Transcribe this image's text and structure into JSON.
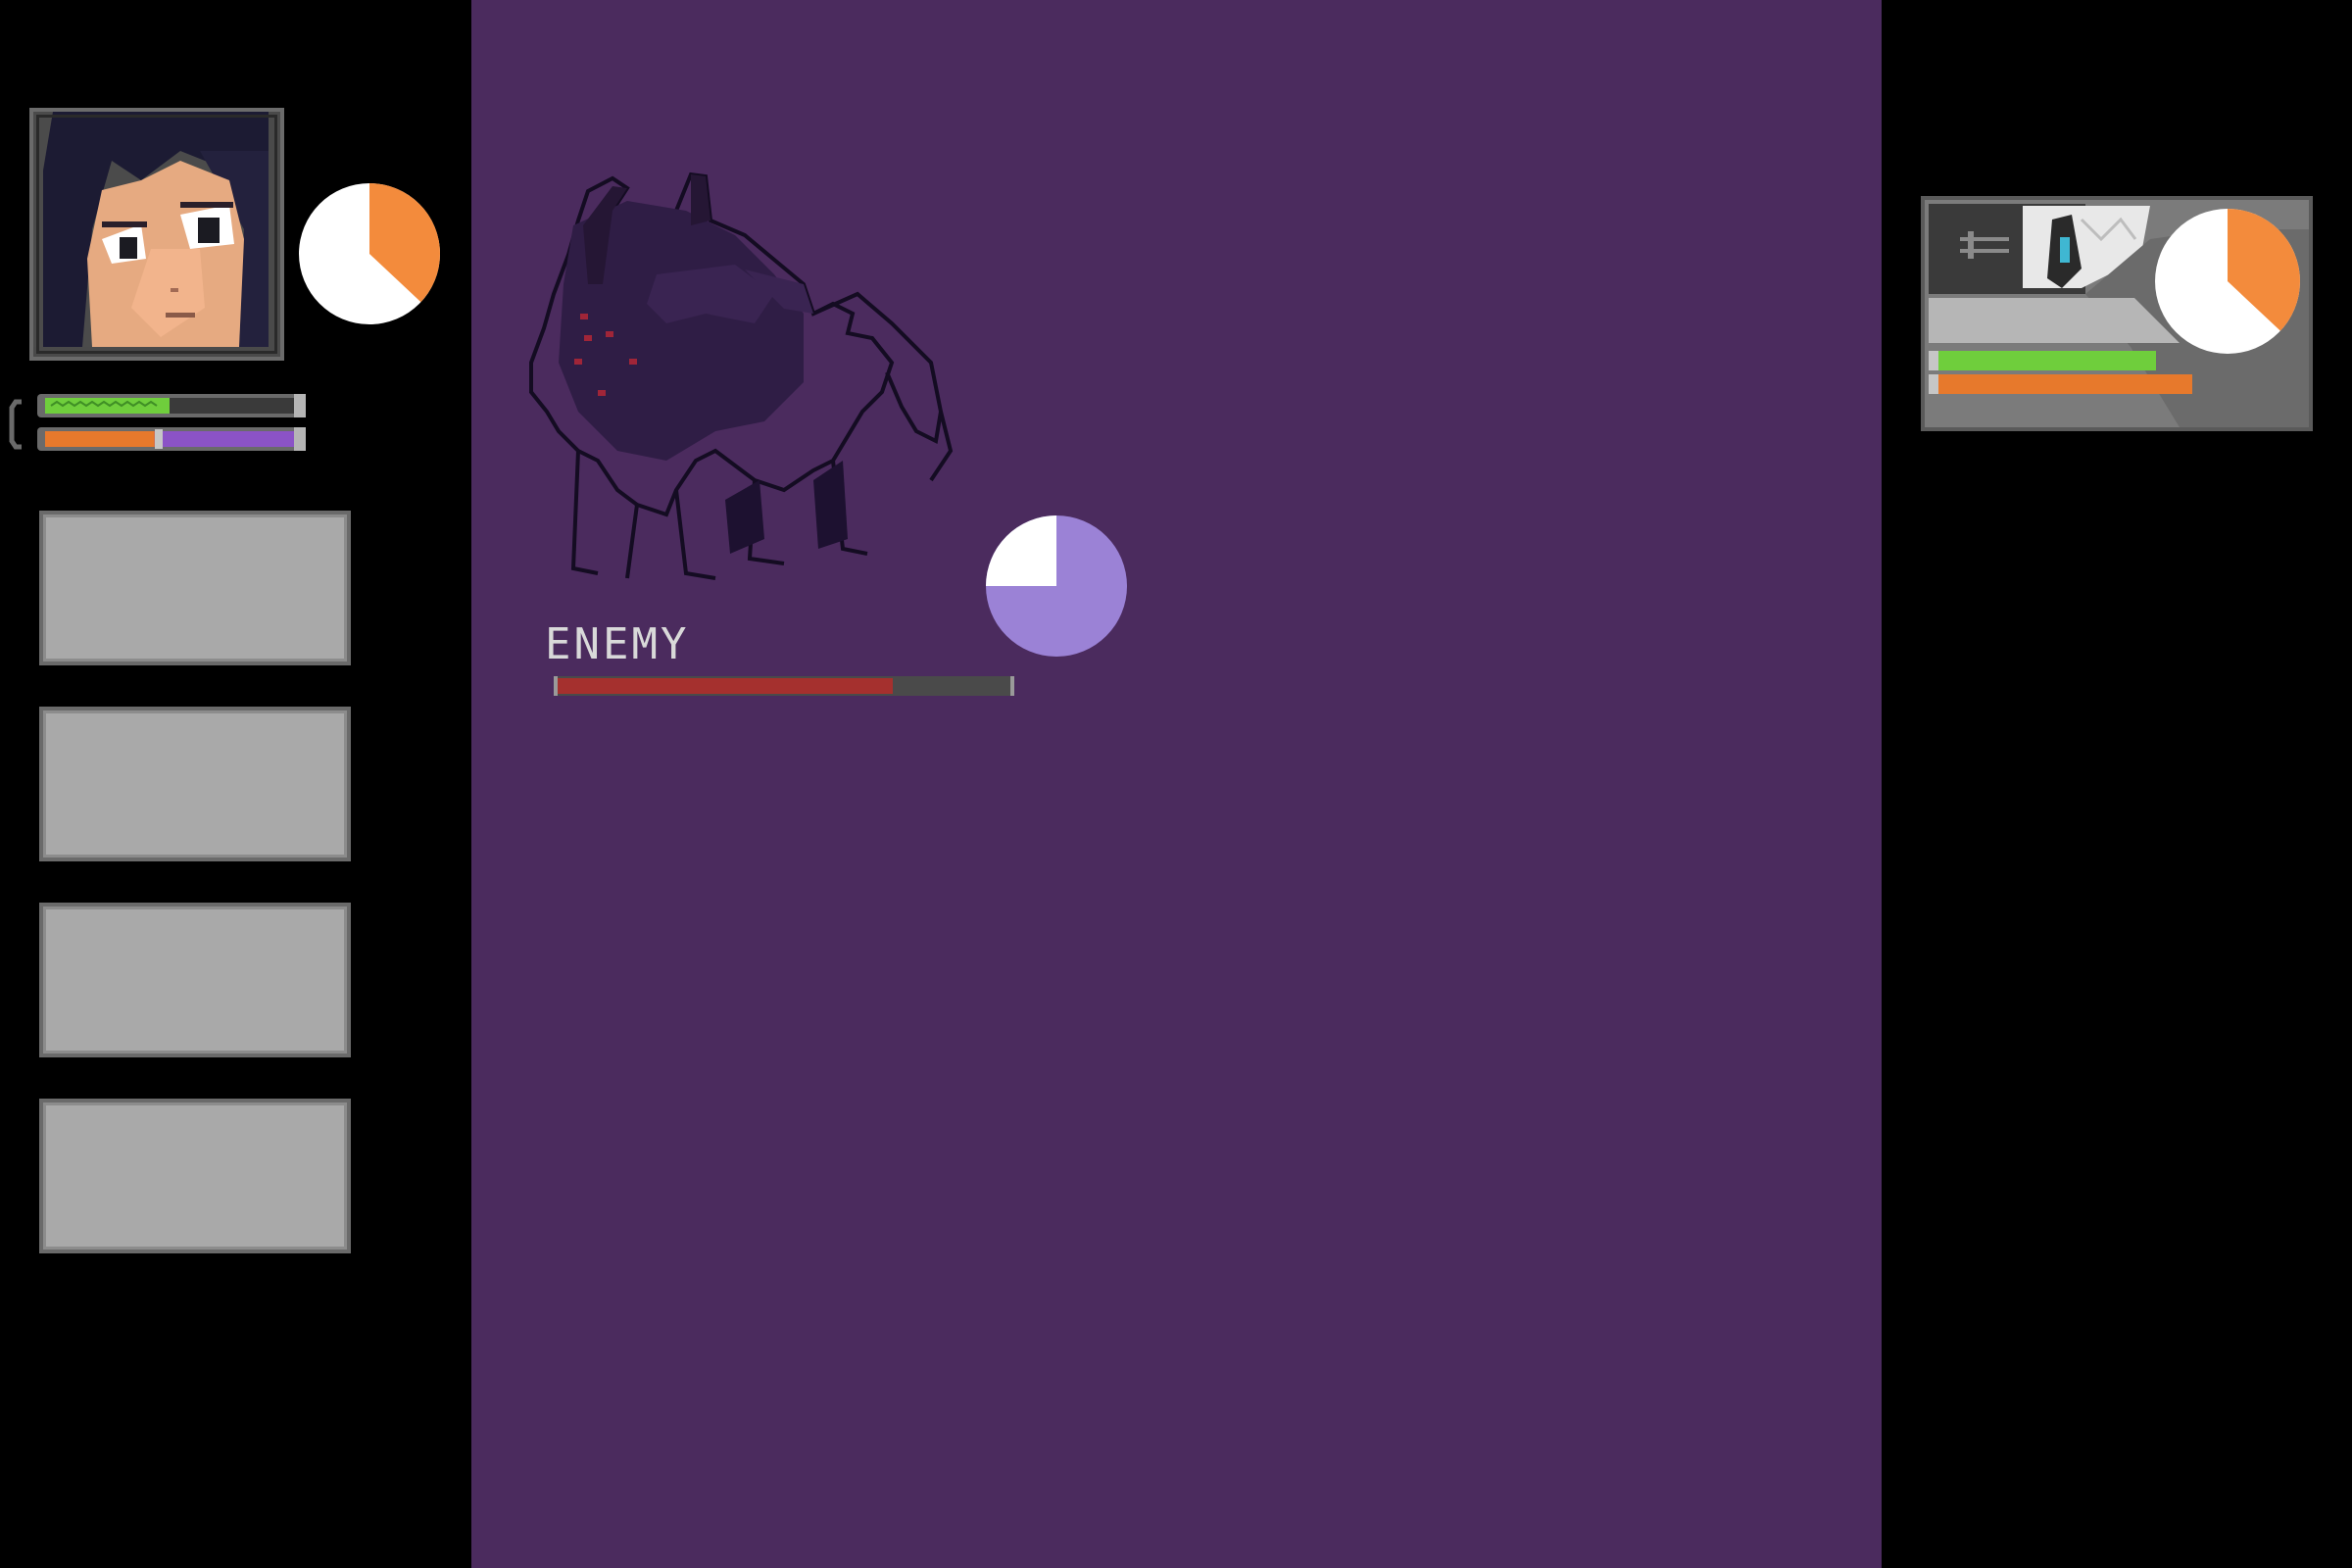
{
  "player": {
    "portrait": "dark-haired-girl-portrait",
    "turn_timer_fraction": 0.37,
    "health_fraction": 0.5,
    "stamina_fraction": 0.44,
    "colors": {
      "health": "#6fce3c",
      "stamina": "#e7792c",
      "mana": "#8b53c6",
      "timer": "#f38b3c"
    }
  },
  "action_slots": [
    "",
    "",
    "",
    ""
  ],
  "enemy": {
    "name": "ENEMY",
    "sprite": "shadow-beast-sprite",
    "hp_fraction": 0.74,
    "turn_timer_fraction": 0.25,
    "colors": {
      "hp": "#a5302e",
      "timer": "#9b82d6"
    }
  },
  "ally": {
    "portrait": "white-haired-ally-portrait",
    "turn_timer_fraction": 0.37,
    "health_fraction": 0.6,
    "stamina_fraction": 0.7,
    "colors": {
      "health": "#6fce3c",
      "stamina": "#e7792c",
      "timer": "#f38b3c"
    }
  }
}
